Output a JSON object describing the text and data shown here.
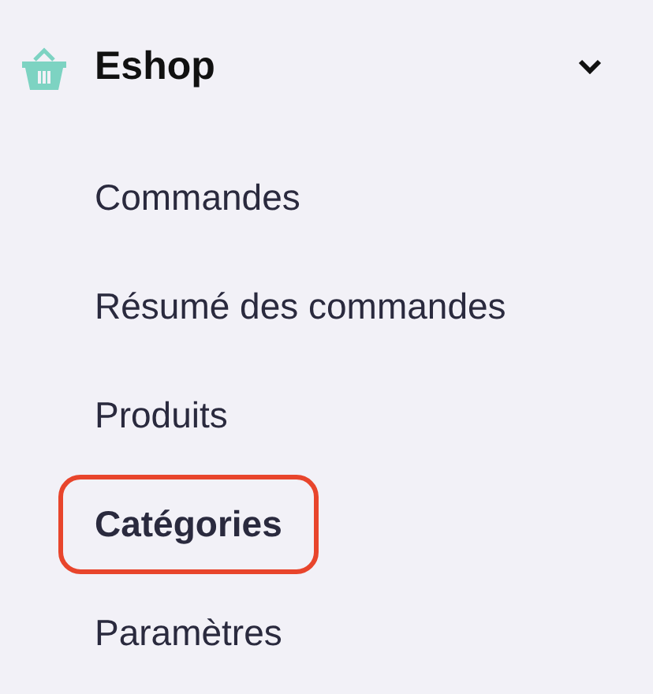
{
  "section": {
    "title": "Eshop",
    "expanded": true
  },
  "items": [
    {
      "label": "Commandes",
      "selected": false,
      "highlighted": false
    },
    {
      "label": "Résumé des commandes",
      "selected": false,
      "highlighted": false
    },
    {
      "label": "Produits",
      "selected": false,
      "highlighted": false
    },
    {
      "label": "Catégories",
      "selected": true,
      "highlighted": true
    },
    {
      "label": "Paramètres",
      "selected": false,
      "highlighted": false
    }
  ]
}
